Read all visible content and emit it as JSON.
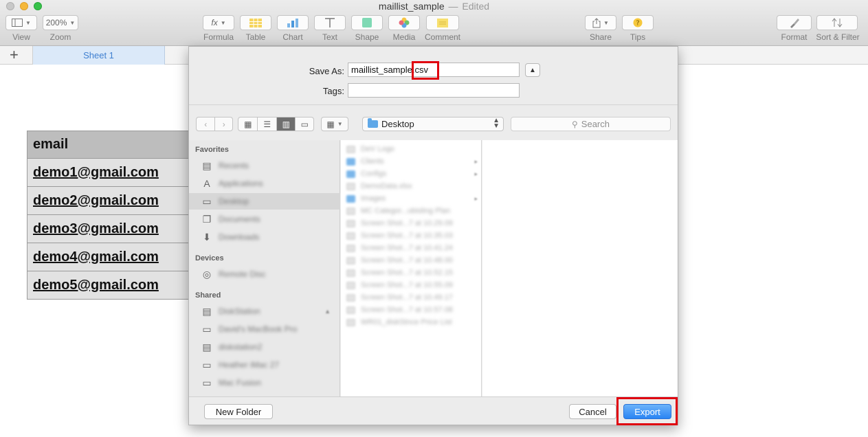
{
  "window": {
    "title": "maillist_sample",
    "status": "Edited",
    "separator": "—"
  },
  "toolbar": {
    "view_label": "View",
    "zoom_value": "200%",
    "zoom_label": "Zoom",
    "formula_icon": "fx",
    "formula_label": "Formula",
    "table_label": "Table",
    "chart_label": "Chart",
    "text_label": "Text",
    "shape_label": "Shape",
    "media_label": "Media",
    "comment_label": "Comment",
    "share_label": "Share",
    "tips_label": "Tips",
    "format_label": "Format",
    "sort_filter_label": "Sort & Filter"
  },
  "sheet_tabs": {
    "add_symbol": "+",
    "active": "Sheet 1"
  },
  "table": {
    "header": "email",
    "rows": [
      "demo1@gmail.com",
      "demo2@gmail.com",
      "demo3@gmail.com",
      "demo4@gmail.com",
      "demo5@gmail.com"
    ]
  },
  "dialog": {
    "save_as_label": "Save As:",
    "filename_value": "maillist_sample.csv",
    "tags_label": "Tags:",
    "tags_value": "",
    "location": "Desktop",
    "search_placeholder": "Search",
    "sidebar": {
      "favorites_heading": "Favorites",
      "favorites": [
        "Recents",
        "Applications",
        "Desktop",
        "Documents",
        "Downloads"
      ],
      "devices_heading": "Devices",
      "devices": [
        "Remote Disc"
      ],
      "shared_heading": "Shared",
      "shared": [
        "DiskStation",
        "David's MacBook Pro",
        "diskstation2",
        "Heather iMac 27",
        "Mac Fusion"
      ]
    },
    "files": [
      {
        "name": "DeV Logo",
        "kind": "doc"
      },
      {
        "name": "Clients",
        "kind": "folder",
        "arrow": true
      },
      {
        "name": "Configs",
        "kind": "folder",
        "arrow": true
      },
      {
        "name": "DemoData.xlsx",
        "kind": "doc"
      },
      {
        "name": "Images",
        "kind": "folder",
        "arrow": true
      },
      {
        "name": "MC Categor...ubisling Plan",
        "kind": "doc"
      },
      {
        "name": "Screen Shot...7 at 10.29.09",
        "kind": "doc"
      },
      {
        "name": "Screen Shot...7 at 10.35.03",
        "kind": "doc"
      },
      {
        "name": "Screen Shot...7 at 10.41.24",
        "kind": "doc"
      },
      {
        "name": "Screen Shot...7 at 10.48.00",
        "kind": "doc"
      },
      {
        "name": "Screen Shot...7 at 10.52.15",
        "kind": "doc"
      },
      {
        "name": "Screen Shot...7 at 10.55.09",
        "kind": "doc"
      },
      {
        "name": "Screen Shot...7 at 10.49.17",
        "kind": "doc"
      },
      {
        "name": "Screen Shot...7 at 10.57.08",
        "kind": "doc"
      },
      {
        "name": "WR01_diskStnce Price List",
        "kind": "doc"
      }
    ],
    "new_folder_label": "New Folder",
    "cancel_label": "Cancel",
    "export_label": "Export"
  },
  "colors": {
    "highlight": "#e0000f",
    "accent": "#2a84f3",
    "tab_active": "#3f7fd0"
  }
}
